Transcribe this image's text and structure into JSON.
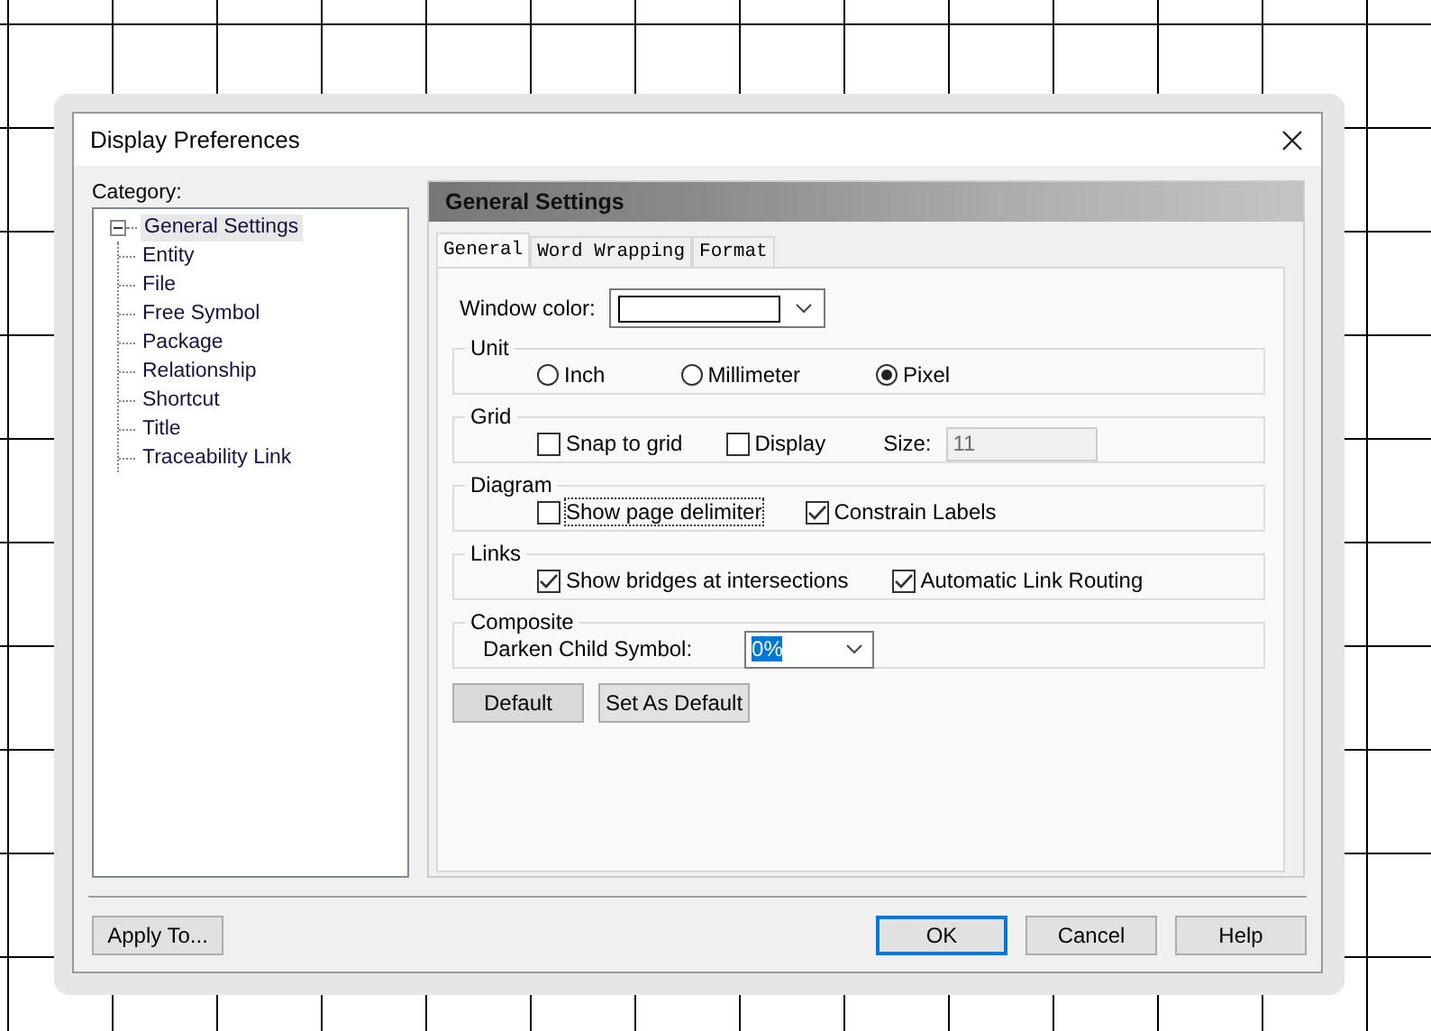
{
  "window": {
    "title": "Display Preferences"
  },
  "category_label": "Category:",
  "tree": {
    "label": "General Settings",
    "expanded": true,
    "selected": true,
    "children": [
      {
        "label": "Entity"
      },
      {
        "label": "File"
      },
      {
        "label": "Free Symbol"
      },
      {
        "label": "Package"
      },
      {
        "label": "Relationship"
      },
      {
        "label": "Shortcut"
      },
      {
        "label": "Title"
      },
      {
        "label": "Traceability Link"
      }
    ]
  },
  "panel": {
    "header": "General Settings"
  },
  "tabs": [
    {
      "label": "General",
      "selected": true
    },
    {
      "label": "Word Wrapping",
      "selected": false
    },
    {
      "label": "Format",
      "selected": false
    }
  ],
  "window_color": {
    "label": "Window color:"
  },
  "groups": [
    {
      "title": "Unit",
      "items": [
        {
          "kind": "radio",
          "label": "Inch",
          "selected": false
        },
        {
          "kind": "radio",
          "label": "Millimeter",
          "selected": false
        },
        {
          "kind": "radio",
          "label": "Pixel",
          "selected": true
        }
      ]
    },
    {
      "title": "Grid",
      "items": [
        {
          "kind": "checkbox",
          "label": "Snap to grid",
          "checked": false
        },
        {
          "kind": "checkbox",
          "label": "Display",
          "checked": false
        },
        {
          "kind": "field",
          "label": "Size:",
          "value": "11",
          "disabled": true
        }
      ]
    },
    {
      "title": "Diagram",
      "items": [
        {
          "kind": "checkbox",
          "label": "Show page delimiter",
          "checked": false,
          "focused": true
        },
        {
          "kind": "checkbox",
          "label": "Constrain Labels",
          "checked": true
        }
      ]
    },
    {
      "title": "Links",
      "items": [
        {
          "kind": "checkbox",
          "label": "Show bridges at intersections",
          "checked": true
        },
        {
          "kind": "checkbox",
          "label": "Automatic Link Routing",
          "checked": true
        }
      ]
    },
    {
      "title": "Composite",
      "items": [
        {
          "kind": "dropdown",
          "label": "Darken Child Symbol:",
          "value": "0%",
          "highlighted": true
        }
      ]
    }
  ],
  "panel_buttons": [
    {
      "label": "Default"
    },
    {
      "label": "Set As Default"
    }
  ],
  "footer_left": {
    "label": "Apply To..."
  },
  "footer_buttons": [
    {
      "label": "OK",
      "default": true
    },
    {
      "label": "Cancel",
      "default": false
    },
    {
      "label": "Help",
      "default": false
    }
  ]
}
